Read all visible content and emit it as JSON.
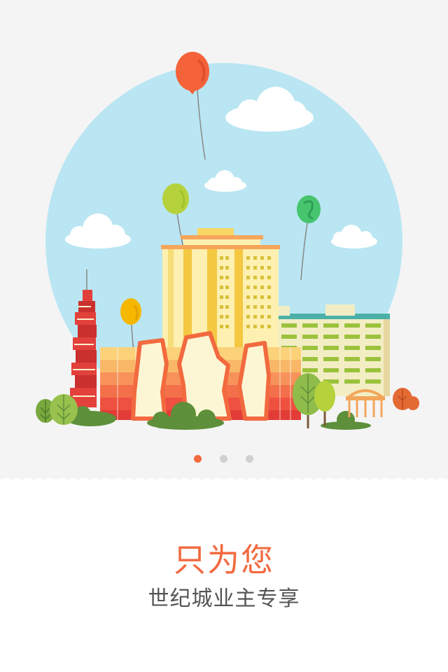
{
  "onboarding": {
    "title": "只为您",
    "subtitle": "世纪城业主专享",
    "title_color": "#f26a3f",
    "subtitle_color": "#555555",
    "illustration": "city-skyline-with-balloons",
    "pager": {
      "count": 3,
      "active_index": 0,
      "active_color": "#f26a3f",
      "inactive_color": "#d0d0d0"
    }
  },
  "colors": {
    "sky": "#b9e6f2",
    "background": "#f4f4f4"
  }
}
